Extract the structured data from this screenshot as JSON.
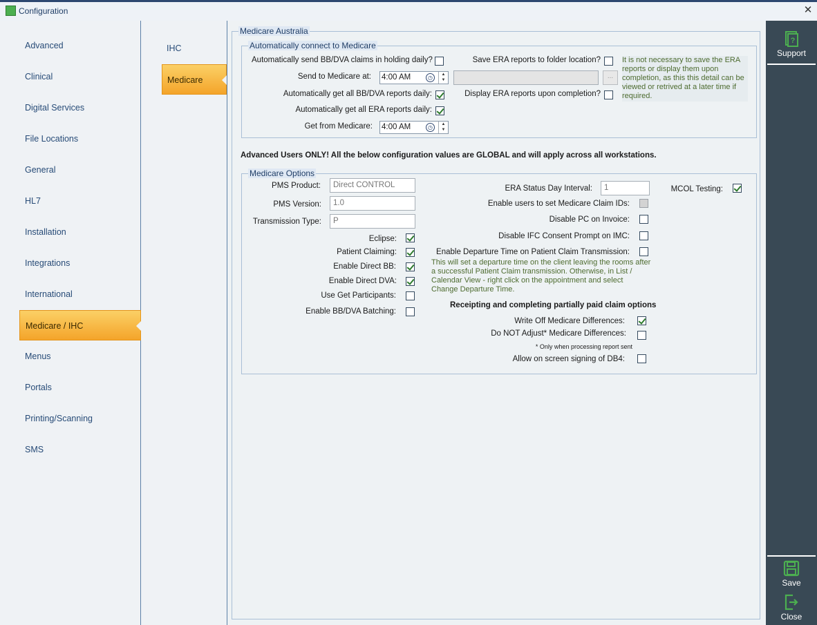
{
  "window": {
    "title": "Configuration",
    "close_glyph": "✕"
  },
  "left_nav": {
    "items": [
      {
        "label": "Advanced"
      },
      {
        "label": "Clinical"
      },
      {
        "label": "Digital Services"
      },
      {
        "label": "File Locations"
      },
      {
        "label": "General"
      },
      {
        "label": "HL7"
      },
      {
        "label": "Installation"
      },
      {
        "label": "Integrations"
      },
      {
        "label": "International"
      },
      {
        "label": "Medicare / IHC"
      },
      {
        "label": "Menus"
      },
      {
        "label": "Portals"
      },
      {
        "label": "Printing/Scanning"
      },
      {
        "label": "SMS"
      }
    ],
    "selected": "Medicare / IHC"
  },
  "sub_nav": {
    "items": [
      {
        "label": "IHC"
      },
      {
        "label": "Medicare"
      }
    ],
    "selected": "Medicare"
  },
  "medicare_australia": {
    "title": "Medicare Australia",
    "auto_connect": {
      "title": "Automatically connect to Medicare",
      "send_holding_label": "Automatically send BB/DVA claims in holding daily?",
      "send_holding_checked": false,
      "send_at_label": "Send to Medicare at:",
      "send_at_value": "4:00 AM",
      "get_bbdva_label": "Automatically get all BB/DVA reports daily:",
      "get_bbdva_checked": true,
      "get_era_label": "Automatically get all ERA reports daily:",
      "get_era_checked": true,
      "get_from_label": "Get from Medicare:",
      "get_from_value": "4:00 AM",
      "save_era_label": "Save ERA reports to folder location?",
      "save_era_checked": false,
      "folder_path_value": "",
      "browse_label": "...",
      "display_era_label": "Display ERA reports upon completion?",
      "display_era_checked": false,
      "era_note": "It is not necessary to save the ERA reports or display them upon completion, as this this detail can be viewed or retrived at a later time if required."
    }
  },
  "advanced_warning": "Advanced Users ONLY! All the below configuration values are GLOBAL and will apply across all workstations.",
  "medicare_options": {
    "title": "Medicare Options",
    "pms_product_label": "PMS Product:",
    "pms_product_value": "Direct CONTROL",
    "pms_version_label": "PMS Version:",
    "pms_version_value": "1.0",
    "transmission_type_label": "Transmission Type:",
    "transmission_type_value": "P",
    "eclipse_label": "Eclipse:",
    "eclipse_checked": true,
    "patient_claiming_label": "Patient Claiming:",
    "patient_claiming_checked": true,
    "enable_direct_bb_label": "Enable Direct BB:",
    "enable_direct_bb_checked": true,
    "enable_direct_dva_label": "Enable Direct DVA:",
    "enable_direct_dva_checked": true,
    "use_get_participants_label": "Use Get Participants:",
    "use_get_participants_checked": false,
    "enable_batching_label": "Enable BB/DVA Batching:",
    "enable_batching_checked": false,
    "era_status_interval_label": "ERA Status Day Interval:",
    "era_status_interval_value": "1",
    "enable_claim_ids_label": "Enable users to set Medicare Claim IDs:",
    "enable_claim_ids_checked": false,
    "disable_pc_invoice_label": "Disable PC on Invoice:",
    "disable_pc_invoice_checked": false,
    "disable_ifc_label": "Disable IFC Consent Prompt on IMC:",
    "disable_ifc_checked": false,
    "departure_time_label": "Enable Departure Time on Patient Claim Transmission:",
    "departure_time_checked": false,
    "departure_note": "This will set a departure time on the client leaving the rooms after a successful Patient Claim transmission. Otherwise, in List / Calendar View - right click on the appointment and select Change Departure Time.",
    "receipting_heading": "Receipting and completing partially paid claim options",
    "write_off_label": "Write Off Medicare Differences:",
    "write_off_checked": true,
    "do_not_adjust_label": "Do NOT Adjust* Medicare Differences:",
    "do_not_adjust_checked": false,
    "only_when_note": "* Only when processing report sent",
    "allow_db4_label": "Allow on screen signing of DB4:",
    "allow_db4_checked": false,
    "mcol_testing_label": "MCOL Testing:",
    "mcol_testing_checked": true
  },
  "right_bar": {
    "support_label": "Support",
    "save_label": "Save",
    "close_label": "Close"
  },
  "icons": {
    "app": "app-icon",
    "support": "support-book-icon",
    "save": "floppy-disk-icon",
    "close": "exit-door-icon",
    "clock": "clock-icon"
  },
  "colors": {
    "accent_orange": "#f4a42a",
    "nav_text": "#274b77",
    "sidebar_dark": "#394955",
    "icon_green": "#4caf50"
  }
}
